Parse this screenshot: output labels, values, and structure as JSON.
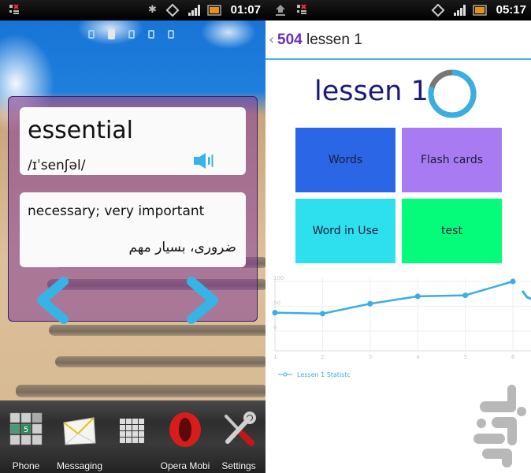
{
  "left_screen": {
    "statusbar": {
      "time": "01:07",
      "icons": [
        "notification-debug-icon",
        "bluetooth-icon",
        "rotation-icon",
        "signal-icon",
        "battery-icon"
      ]
    },
    "home_pages": {
      "count": 5,
      "active_index": 1
    },
    "widget": {
      "word": "essential",
      "phonetic": "/ɪˈsenʃəl/",
      "speaker_icon": "speaker-icon",
      "definition_en": "necessary; very important",
      "definition_fa": "ضروری، بسیار مهم",
      "prev_icon": "chevron-left-icon",
      "next_icon": "chevron-right-icon",
      "accent_color": "#37b4e6"
    },
    "dock": [
      {
        "label": "Phone",
        "icon": "phone-dialpad-icon"
      },
      {
        "label": "Messaging",
        "icon": "envelope-icon"
      },
      {
        "label": "",
        "icon": "app-drawer-grid-icon"
      },
      {
        "label": "Opera Mobi",
        "icon": "opera-icon"
      },
      {
        "label": "Settings",
        "icon": "wrench-screwdriver-icon"
      }
    ]
  },
  "right_screen": {
    "statusbar": {
      "time": "05:17",
      "icons": [
        "upload-icon",
        "notification-debug-icon",
        "rotation-icon",
        "signal-icon",
        "battery-icon"
      ]
    },
    "actionbar": {
      "back_glyph": "‹",
      "app_number": "504",
      "title": "lessen 1"
    },
    "lesson": {
      "title": "lessen 1",
      "progress_fraction": 0.8,
      "ring_colors": {
        "done": "#3aaee0",
        "remaining": "#777777"
      }
    },
    "tiles": [
      {
        "label": "Words",
        "color": "#2a66e6"
      },
      {
        "label": "Flash cards",
        "color": "#a87bf2"
      },
      {
        "label": "Word in Use",
        "color": "#2ee0ee"
      },
      {
        "label": "test",
        "color": "#05fc7a"
      }
    ],
    "chart_data": {
      "type": "line",
      "title": "",
      "xlabel": "",
      "ylabel": "",
      "x": [
        1,
        2,
        3,
        4,
        5,
        6
      ],
      "x_tick_labels": [
        "1",
        "2",
        "3",
        "4",
        "5",
        "6"
      ],
      "y_tick_labels": [
        "0",
        "50",
        "100"
      ],
      "ylim": [
        -40,
        100
      ],
      "series": [
        {
          "name": "Lessen 1 Statistc",
          "values": [
            37,
            35,
            55,
            70,
            72,
            100
          ],
          "color": "#3aaee0"
        }
      ],
      "grid": true,
      "legend": "bottom-left"
    },
    "brand_logo": "app-store-logo-icon"
  }
}
